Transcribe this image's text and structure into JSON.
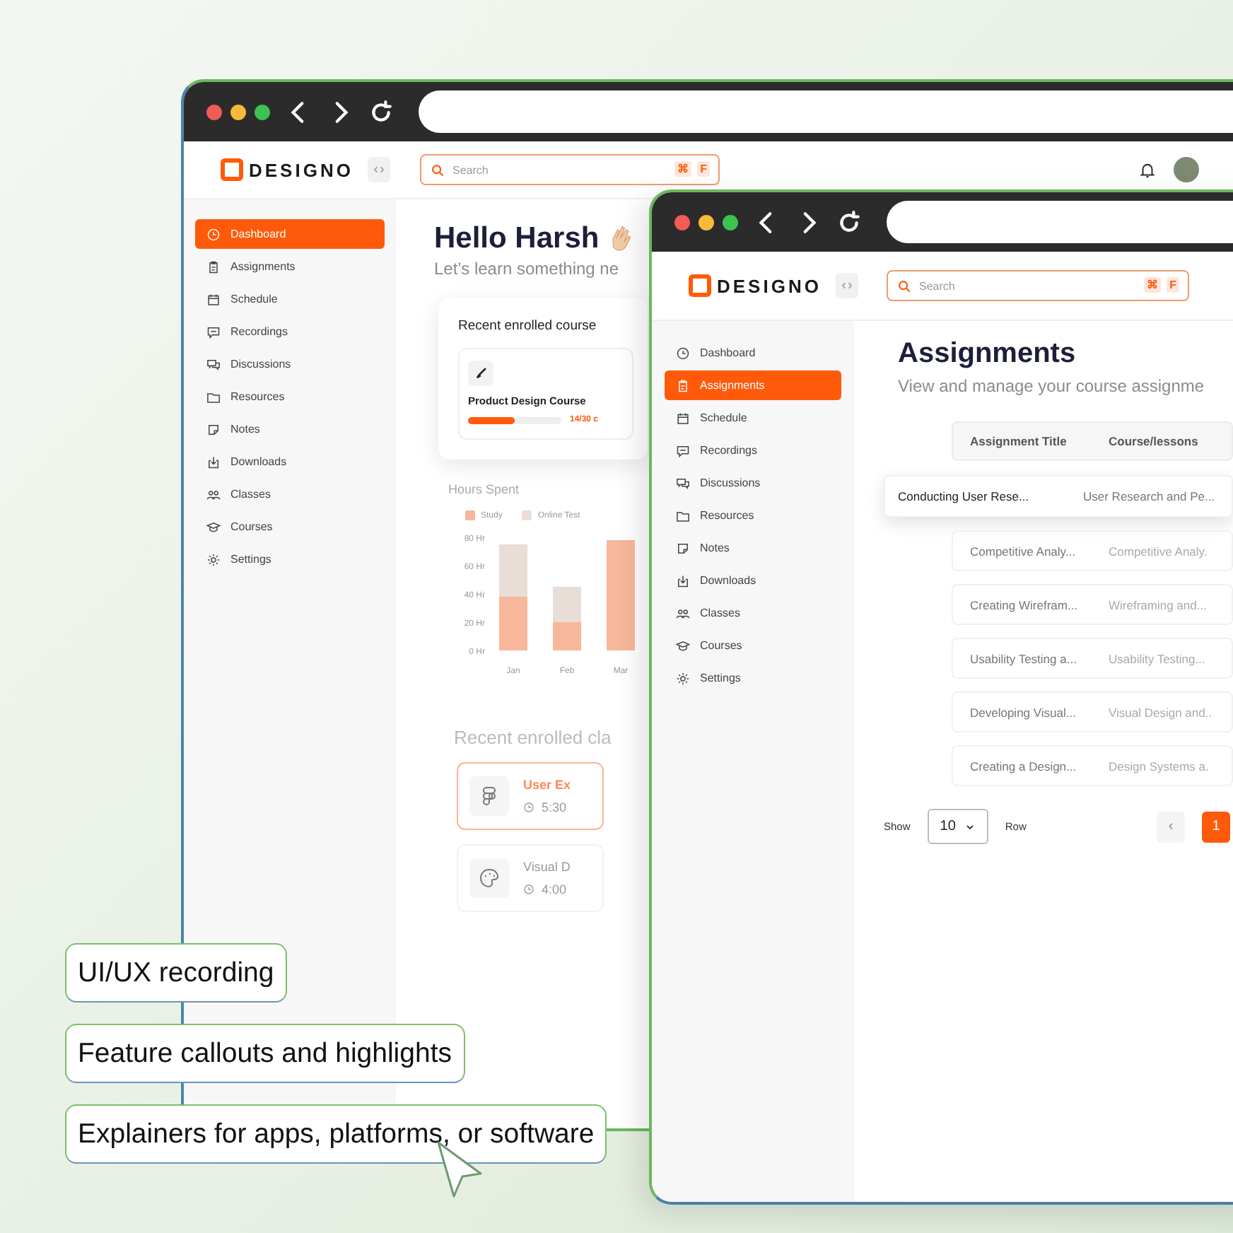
{
  "background_window": {
    "logo": "DESIGNO",
    "search": {
      "placeholder": "Search",
      "keys": [
        "⌘",
        "F"
      ]
    },
    "sidebar": [
      {
        "label": "Dashboard",
        "selected": true
      },
      {
        "label": "Assignments",
        "selected": false
      },
      {
        "label": "Schedule",
        "selected": false
      },
      {
        "label": "Recordings",
        "selected": false
      },
      {
        "label": "Discussions",
        "selected": false
      },
      {
        "label": "Resources",
        "selected": false
      },
      {
        "label": "Notes",
        "selected": false
      },
      {
        "label": "Downloads",
        "selected": false
      },
      {
        "label": "Classes",
        "selected": false
      },
      {
        "label": "Courses",
        "selected": false
      },
      {
        "label": "Settings",
        "selected": false
      }
    ],
    "greeting": "Hello Harsh",
    "subtitle": "Let’s learn something ne",
    "enrolled_card": {
      "title": "Recent enrolled course",
      "course": "Product Design Course",
      "level": 0.5,
      "progress_text": "14/30 c"
    },
    "hours": {
      "title": "Hours Spent",
      "chart_data": {
        "type": "bar",
        "stacked": true,
        "categories": [
          "Jan",
          "Feb",
          "Mar"
        ],
        "series": [
          {
            "name": "Study",
            "color": "#f7b79a",
            "values": [
              38,
              20,
              78
            ]
          },
          {
            "name": "Online Test",
            "color": "#e9ded7",
            "values": [
              37,
              25,
              0
            ]
          }
        ],
        "ylim": [
          0,
          80
        ],
        "yticks": [
          {
            "value": 0,
            "label": "0 Hr"
          },
          {
            "value": 20,
            "label": "20 Hr"
          },
          {
            "value": 40,
            "label": "40 Hr"
          },
          {
            "value": 60,
            "label": "60 Hr"
          },
          {
            "value": 80,
            "label": "80 Hr"
          }
        ]
      }
    },
    "classes": {
      "title": "Recent enrolled cla",
      "items": [
        {
          "name": "User Ex",
          "time": "5:30",
          "selected": true
        },
        {
          "name": "Visual D",
          "time": "4:00",
          "selected": false
        }
      ]
    }
  },
  "front_window": {
    "logo": "DESIGNO",
    "search": {
      "placeholder": "Search",
      "keys": [
        "⌘",
        "F"
      ]
    },
    "sidebar": [
      {
        "label": "Dashboard",
        "selected": false
      },
      {
        "label": "Assignments",
        "selected": true
      },
      {
        "label": "Schedule",
        "selected": false
      },
      {
        "label": "Recordings",
        "selected": false
      },
      {
        "label": "Discussions",
        "selected": false
      },
      {
        "label": "Resources",
        "selected": false
      },
      {
        "label": "Notes",
        "selected": false
      },
      {
        "label": "Downloads",
        "selected": false
      },
      {
        "label": "Classes",
        "selected": false
      },
      {
        "label": "Courses",
        "selected": false
      },
      {
        "label": "Settings",
        "selected": false
      }
    ],
    "title": "Assignments",
    "subtitle": "View and manage your course assignme",
    "table": {
      "columns": [
        "Assignment Title",
        "Course/lessons"
      ],
      "rows": [
        {
          "title": "Conducting User Rese...",
          "course": "User Research and Pe...",
          "selected": true
        },
        {
          "title": "Competitive Analy...",
          "course": "Competitive Analy.",
          "selected": false
        },
        {
          "title": "Creating Wirefram...",
          "course": "Wireframing and...",
          "selected": false
        },
        {
          "title": "Usability Testing a...",
          "course": "Usability Testing...",
          "selected": false
        },
        {
          "title": "Developing Visual...",
          "course": "Visual Design and..",
          "selected": false
        },
        {
          "title": "Creating a Design...",
          "course": "Design Systems a.",
          "selected": false
        }
      ]
    },
    "pagination": {
      "show_label": "Show",
      "rows_value": "10",
      "row_label": "Row",
      "prev": {
        "label": "‹",
        "disabled": true
      },
      "pages": [
        {
          "label": "1",
          "selected": true
        }
      ]
    }
  },
  "callouts": [
    "UI/UX recording",
    "Feature callouts and highlights",
    "Explainers for apps, platforms, or software"
  ]
}
